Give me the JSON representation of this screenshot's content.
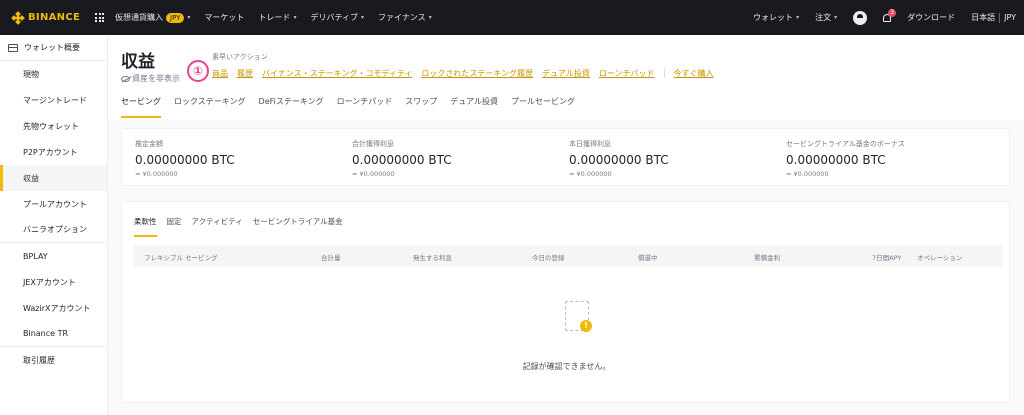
{
  "topbar": {
    "logo_text": "BINANCE",
    "nav": [
      {
        "label": "仮想通貨購入",
        "badge": "JPY",
        "caret": "▾"
      },
      {
        "label": "マーケット"
      },
      {
        "label": "トレード",
        "caret": "▾"
      },
      {
        "label": "デリバティブ",
        "caret": "▾"
      },
      {
        "label": "ファイナンス",
        "caret": "▾"
      }
    ],
    "right": {
      "wallet": "ウォレット",
      "orders": "注文",
      "notifications_count": "3",
      "download": "ダウンロード",
      "language": "日本語",
      "currency": "JPY",
      "caret": "▾"
    }
  },
  "sidebar": {
    "items": [
      {
        "label": "ウォレット概要"
      },
      {
        "label": "現物"
      },
      {
        "label": "マージントレード"
      },
      {
        "label": "先物ウォレット"
      },
      {
        "label": "P2Pアカウント"
      },
      {
        "label": "収益"
      },
      {
        "label": "プールアカウント"
      },
      {
        "label": "バニラオプション"
      },
      {
        "label": "BPLAY"
      },
      {
        "label": "JEXアカウント"
      },
      {
        "label": "WazirXアカウント"
      },
      {
        "label": "Binance TR"
      },
      {
        "label": "取引履歴"
      }
    ]
  },
  "header": {
    "title": "収益",
    "hide_assets": "資産を非表示",
    "marker": "①",
    "quick_actions_label": "素早いアクション",
    "quick_links": [
      "商品",
      "履歴",
      "バイナンス・ステーキング・コモディティ",
      "ロックされたステーキング履歴",
      "デュアル投資",
      "ローンチパッド"
    ],
    "buy_now": "今すぐ購入",
    "tabs": [
      "セービング",
      "ロックステーキング",
      "DeFiステーキング",
      "ローンチパッド",
      "スワップ",
      "デュアル投資",
      "プールセービング"
    ]
  },
  "summary": {
    "stats": [
      {
        "label": "推定金額",
        "value": "0.00000000 BTC",
        "sub": "≈ ¥0.000000"
      },
      {
        "label": "合計獲得利息",
        "value": "0.00000000 BTC",
        "sub": "≈ ¥0.000000"
      },
      {
        "label": "本日獲得利息",
        "value": "0.00000000 BTC",
        "sub": "≈ ¥0.000000"
      },
      {
        "label": "セービングトライアル基金のボーナス",
        "value": "0.00000000 BTC",
        "sub": "≈ ¥0.000000"
      }
    ]
  },
  "list": {
    "tabs": [
      "柔軟性",
      "固定",
      "アクティビティ",
      "セービングトライアル基金"
    ],
    "columns": [
      "フレキシブル セービング",
      "合計量",
      "発生する利息",
      "今日の登録",
      "償還中",
      "累積金利",
      "7日間APY",
      "オペレーション"
    ],
    "empty_icon_glyph": "!",
    "empty_text": "記録が確認できません。"
  },
  "colors": {
    "accent": "#f0b90b",
    "topbar_bg": "#181a20",
    "link": "#c99400",
    "marker": "#e8408c"
  }
}
